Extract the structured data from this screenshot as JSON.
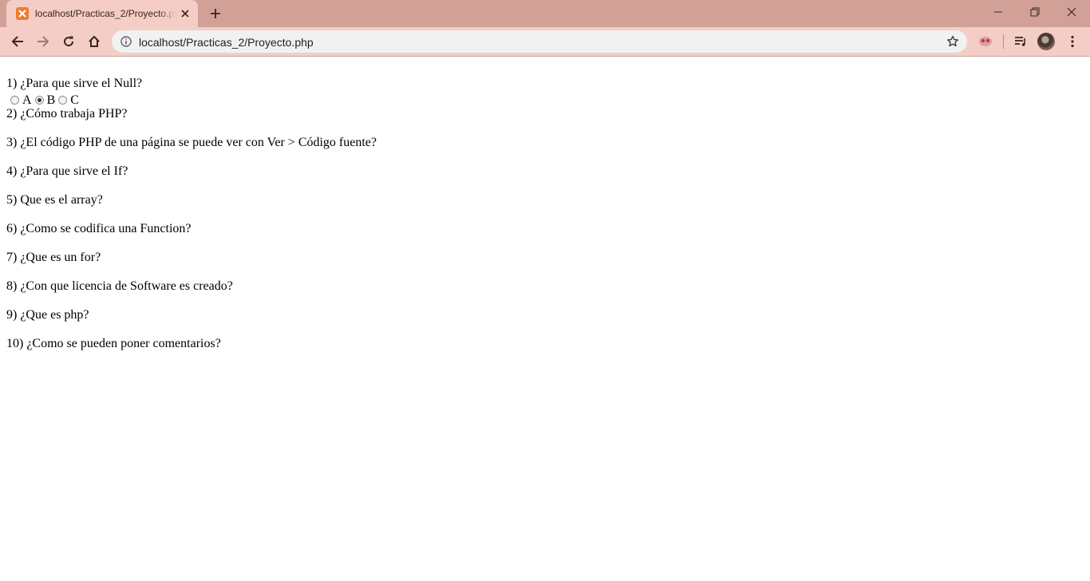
{
  "browser": {
    "tab_title": "localhost/Practicas_2/Proyecto.php",
    "url": "localhost/Practicas_2/Proyecto.php",
    "colors": {
      "titlebar": "#d1a198",
      "toolbar": "#f3cdc6",
      "favicon": "#f07a2e"
    },
    "icons": [
      "xampp-favicon-icon",
      "close-icon",
      "plus-icon",
      "minimize-icon",
      "restore-icon",
      "close-window-icon",
      "back-arrow-icon",
      "forward-arrow-icon",
      "reload-icon",
      "home-icon",
      "info-icon",
      "star-icon",
      "extension-icon",
      "media-queue-icon",
      "avatar",
      "kebab-menu-icon"
    ]
  },
  "quiz": {
    "questions": [
      "1) ¿Para que sirve el Null?",
      "2) ¿Cómo trabaja PHP?",
      "3) ¿El código PHP de una página se puede ver con Ver > Código fuente?",
      "4) ¿Para que sirve el If?",
      "5) Que es el array?",
      "6) ¿Como se codifica una Function?",
      "7) ¿Que es un for?",
      "8) ¿Con que licencia de Software es creado?",
      "9) ¿Que es php?",
      "10) ¿Como se pueden poner comentarios?"
    ],
    "q1_options": [
      {
        "label": "A",
        "checked": false
      },
      {
        "label": "B",
        "checked": true
      },
      {
        "label": "C",
        "checked": false
      }
    ]
  }
}
